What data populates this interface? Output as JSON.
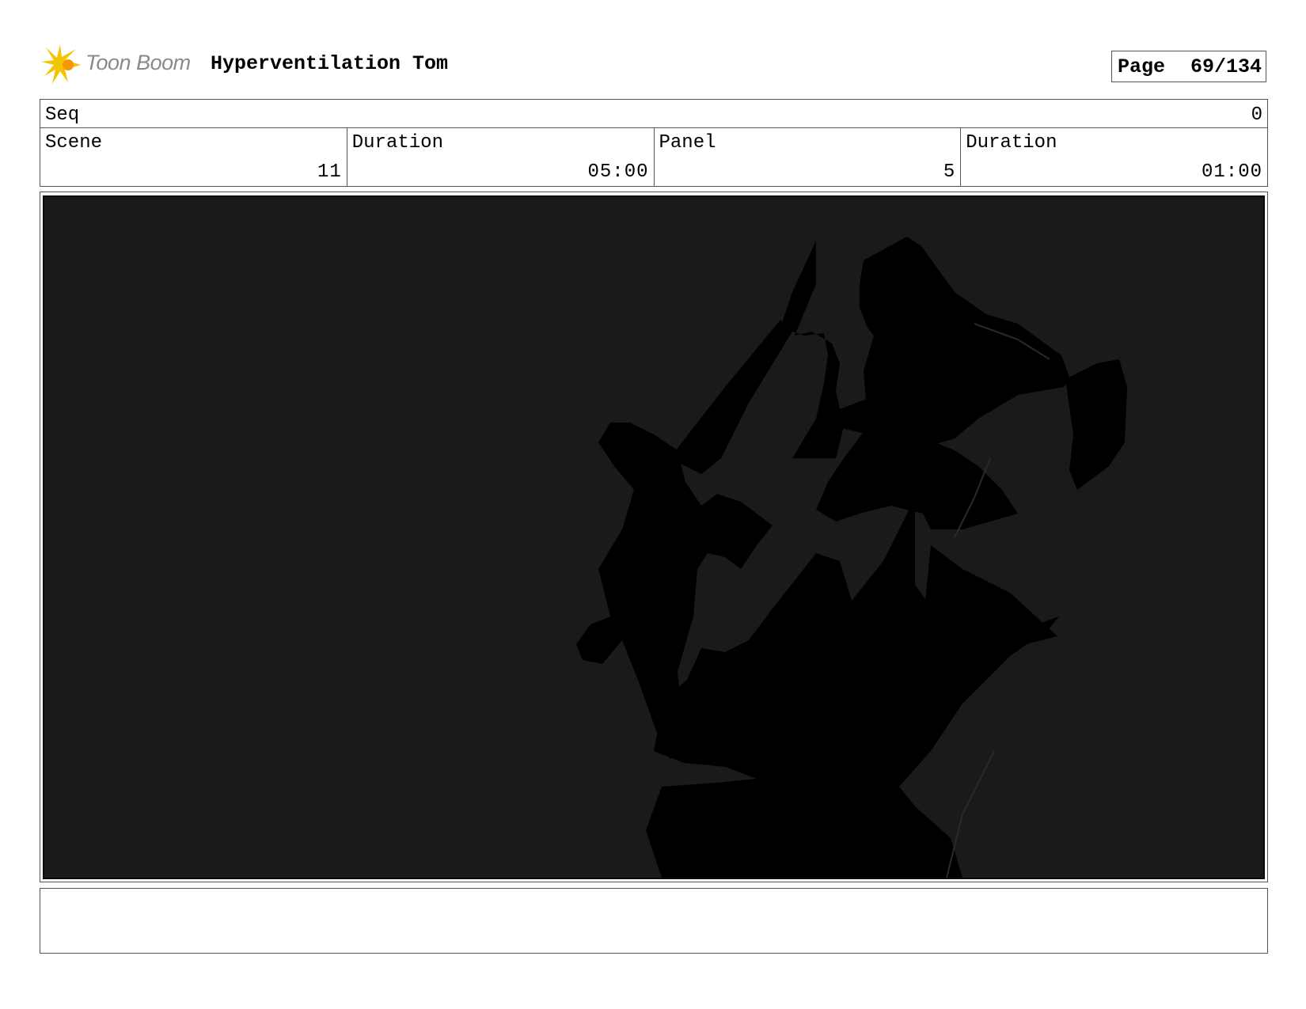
{
  "header": {
    "logo_text": "Toon Boom",
    "project_title": "Hyperventilation Tom",
    "page_label": "Page",
    "page_number": "69/134"
  },
  "seq": {
    "label": "Seq",
    "value": "0"
  },
  "info": {
    "scene_label": "Scene",
    "scene_value": "11",
    "scene_duration_label": "Duration",
    "scene_duration_value": "05:00",
    "panel_label": "Panel",
    "panel_value": "5",
    "panel_duration_label": "Duration",
    "panel_duration_value": "01:00"
  },
  "panel": {
    "background_color": "#1a1a1a",
    "silhouette_color": "#000000"
  },
  "notes": {
    "text": ""
  },
  "colors": {
    "logo_yellow": "#f5c400",
    "logo_orange": "#f39a00",
    "logo_text": "#8a8a8a"
  }
}
